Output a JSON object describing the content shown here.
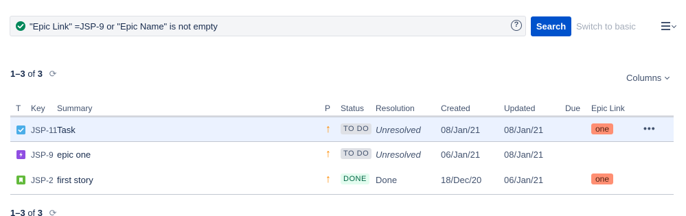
{
  "query": {
    "text": "\"Epic Link\" =JSP-9 or \"Epic Name\" is not empty",
    "help_glyph": "?"
  },
  "toolbar": {
    "search_label": "Search",
    "switch_label": "Switch to basic"
  },
  "pager": {
    "range": "1–3",
    "of": "of",
    "total": "3"
  },
  "columns_label": "Columns",
  "table": {
    "headers": {
      "type": "T",
      "key": "Key",
      "summary": "Summary",
      "priority": "P",
      "status": "Status",
      "resolution": "Resolution",
      "created": "Created",
      "updated": "Updated",
      "due": "Due",
      "epic_link": "Epic Link"
    },
    "rows": [
      {
        "type_icon": "task-icon",
        "key": "JSP-11",
        "summary": "Task",
        "priority": "↑",
        "status": "TO DO",
        "resolution": "Unresolved",
        "created": "08/Jan/21",
        "updated": "08/Jan/21",
        "due": "",
        "epic_link": "one",
        "actions": "•••"
      },
      {
        "type_icon": "epic-icon",
        "key": "JSP-9",
        "summary": "epic one",
        "priority": "↑",
        "status": "TO DO",
        "resolution": "Unresolved",
        "created": "06/Jan/21",
        "updated": "08/Jan/21",
        "due": "",
        "epic_link": ""
      },
      {
        "type_icon": "story-icon",
        "key": "JSP-2",
        "summary": "first story",
        "priority": "↑",
        "status": "DONE",
        "resolution": "Done",
        "created": "18/Dec/20",
        "updated": "06/Jan/21",
        "due": "",
        "epic_link": "one"
      }
    ]
  },
  "colors": {
    "primary": "#0052cc",
    "valid_query": "#00875a",
    "task": "#4bade8",
    "epic": "#904ee2",
    "story": "#63ba3c",
    "priority": "#ff8b00",
    "epic_badge": "#ff8f73"
  }
}
